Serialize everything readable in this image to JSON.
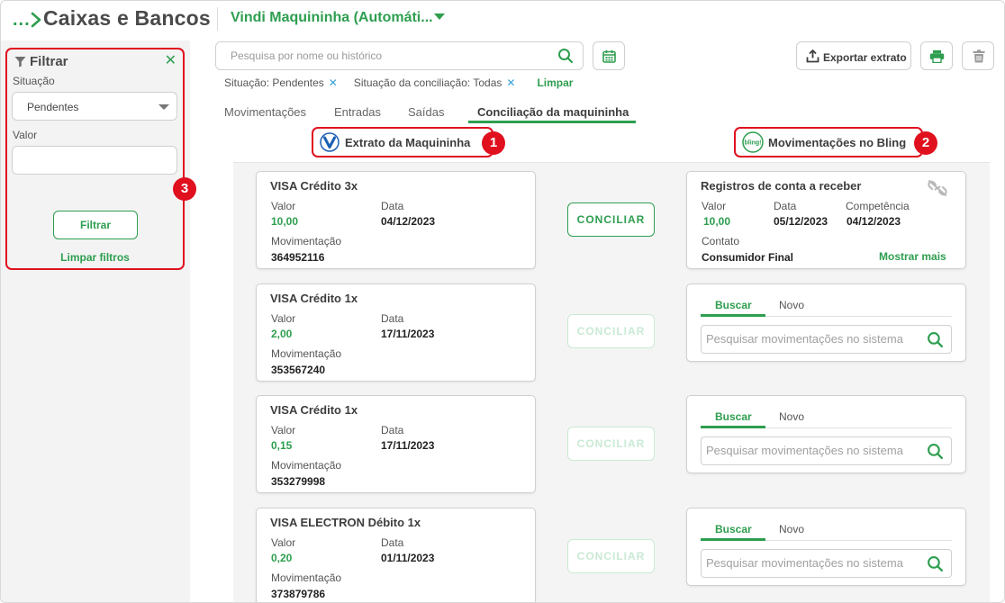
{
  "header": {
    "breadcrumb_dots": "...",
    "title": "Caixas e Bancos",
    "account": "Vindi Maquininha (Automáti..."
  },
  "colors": {
    "accent": "#2e9e4f",
    "highlight": "#e0101e",
    "chip_x": "#38a0d8"
  },
  "filter": {
    "title": "Filtrar",
    "situacao_label": "Situação",
    "situacao_value": "Pendentes",
    "valor_label": "Valor",
    "valor_value": "",
    "button": "Filtrar",
    "clear": "Limpar filtros",
    "badge": "3"
  },
  "search": {
    "placeholder": "Pesquisa por nome ou histórico"
  },
  "toolbar": {
    "export_label": "Exportar extrato"
  },
  "chips": {
    "items": [
      "Situação: Pendentes",
      "Situação da conciliação: Todas"
    ],
    "clear": "Limpar"
  },
  "tabs": {
    "items": [
      "Movimentações",
      "Entradas",
      "Saídas",
      "Conciliação da maquininha"
    ],
    "active": 3
  },
  "columns": {
    "left": {
      "label": "Extrato da Maquininha",
      "badge": "1"
    },
    "right": {
      "label": "Movimentações no Bling",
      "badge": "2",
      "logo_text": "bling!"
    }
  },
  "labels": {
    "valor": "Valor",
    "data": "Data",
    "movimentacao": "Movimentação",
    "conciliar": "CONCILIAR",
    "competencia": "Competência",
    "contato": "Contato",
    "mostrar_mais": "Mostrar mais",
    "buscar": "Buscar",
    "novo": "Novo",
    "mini_search_placeholder": "Pesquisar movimentações no sistema"
  },
  "transactions": [
    {
      "title": "VISA Crédito 3x",
      "valor": "10,00",
      "data": "04/12/2023",
      "movimentacao": "364952116",
      "conciliar_enabled": true
    },
    {
      "title": "VISA Crédito 1x",
      "valor": "2,00",
      "data": "17/11/2023",
      "movimentacao": "353567240",
      "conciliar_enabled": false
    },
    {
      "title": "VISA Crédito 1x",
      "valor": "0,15",
      "data": "17/11/2023",
      "movimentacao": "353279998",
      "conciliar_enabled": false
    },
    {
      "title": "VISA ELECTRON Débito 1x",
      "valor": "0,20",
      "data": "01/11/2023",
      "movimentacao": "373879786",
      "conciliar_enabled": false
    }
  ],
  "match": {
    "title": "Registros de conta a receber",
    "valor": "10,00",
    "data": "05/12/2023",
    "competencia": "04/12/2023",
    "contato": "Consumidor Final"
  }
}
